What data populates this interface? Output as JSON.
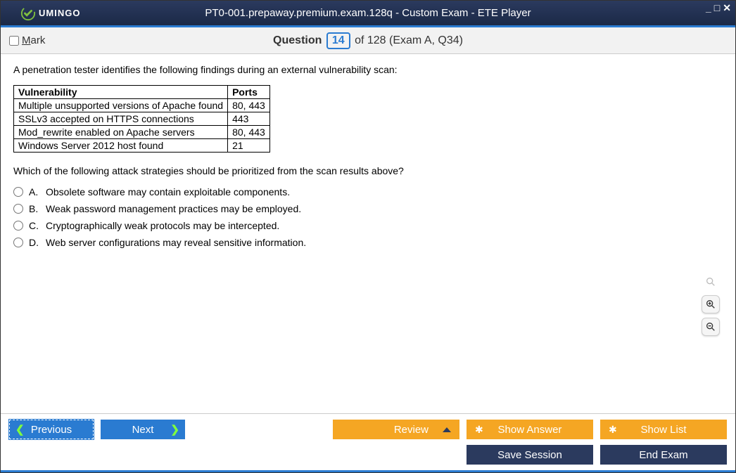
{
  "window": {
    "title": "PT0-001.prepaway.premium.exam.128q - Custom Exam - ETE Player",
    "logo_text": "UMINGO"
  },
  "question_bar": {
    "mark_label_pre": "M",
    "mark_label_rest": "ark",
    "question_label": "Question",
    "current": "14",
    "total": "of 128 (Exam A, Q34)"
  },
  "question": {
    "intro": "A penetration tester identifies the following findings during an external vulnerability scan:",
    "table": {
      "headers": [
        "Vulnerability",
        "Ports"
      ],
      "rows": [
        [
          "Multiple unsupported versions of Apache found",
          "80, 443"
        ],
        [
          "SSLv3 accepted on HTTPS connections",
          "443"
        ],
        [
          "Mod_rewrite enabled on Apache servers",
          "80, 443"
        ],
        [
          "Windows Server 2012 host found",
          "21"
        ]
      ]
    },
    "prompt": "Which of the following attack strategies should be prioritized from the scan results above?",
    "options": [
      {
        "letter": "A.",
        "text": "Obsolete software may contain exploitable components."
      },
      {
        "letter": "B.",
        "text": "Weak password management practices may be employed."
      },
      {
        "letter": "C.",
        "text": "Cryptographically weak protocols may be intercepted."
      },
      {
        "letter": "D.",
        "text": "Web server configurations may reveal sensitive information."
      }
    ]
  },
  "buttons": {
    "previous": "Previous",
    "next": "Next",
    "review": "Review",
    "show_answer": "Show Answer",
    "show_list": "Show List",
    "save_session": "Save Session",
    "end_exam": "End Exam"
  }
}
